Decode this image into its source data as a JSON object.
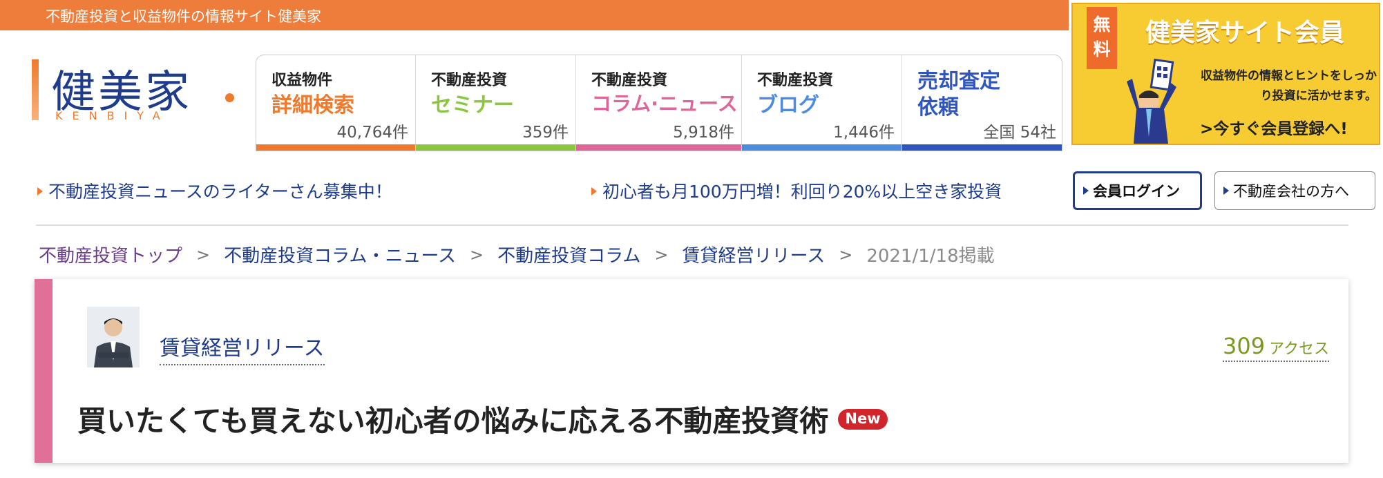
{
  "header": {
    "tagline": "不動産投資と収益物件の情報サイト健美家",
    "logo": {
      "kanji": "健美家",
      "roman": "KENBIYA"
    }
  },
  "nav": [
    {
      "sub": "収益物件",
      "main": "詳細検索",
      "count": "40,764件",
      "color": "#ef7a2e"
    },
    {
      "sub": "不動産投資",
      "main": "セミナー",
      "count": "359件",
      "color": "#8cc63f"
    },
    {
      "sub": "不動産投資",
      "main": "コラム·ニュース",
      "count": "5,918件",
      "color": "#e0669a"
    },
    {
      "sub": "不動産投資",
      "main": "ブログ",
      "count": "1,446件",
      "color": "#4e8bde"
    },
    {
      "main": "売却査定",
      "main2": "依頼",
      "count": "全国 54社",
      "color": "#2f56c0"
    }
  ],
  "banner": {
    "tag": "無料",
    "title": "健美家サイト会員",
    "desc": "収益物件の情報とヒントをしっかり投資に活かせます。",
    "cta": ">今すぐ会員登録へ!"
  },
  "notices": [
    "不動産投資ニュースのライターさん募集中！",
    "初心者も月100万円増！利回り20%以上空き家投資"
  ],
  "buttons": {
    "login": "会員ログイン",
    "company": "不動産会社の方へ"
  },
  "breadcrumb": {
    "items": [
      "不動産投資トップ",
      "不動産投資コラム・ニュース",
      "不動産投資コラム",
      "賃貸経営リリース"
    ],
    "separator": ">",
    "date": "2021/1/18掲載"
  },
  "article": {
    "author": "賃貸経営リリース",
    "access_count": "309",
    "access_unit": "アクセス",
    "title": "買いたくても買えない初心者の悩みに応える不動産投資術",
    "badge": "New"
  },
  "colors": {
    "orange": "#ee7d3b",
    "navy": "#1f3c8c",
    "pink_accent": "#e07097",
    "access_green": "#7a9a1e",
    "new_red": "#d0262b"
  }
}
